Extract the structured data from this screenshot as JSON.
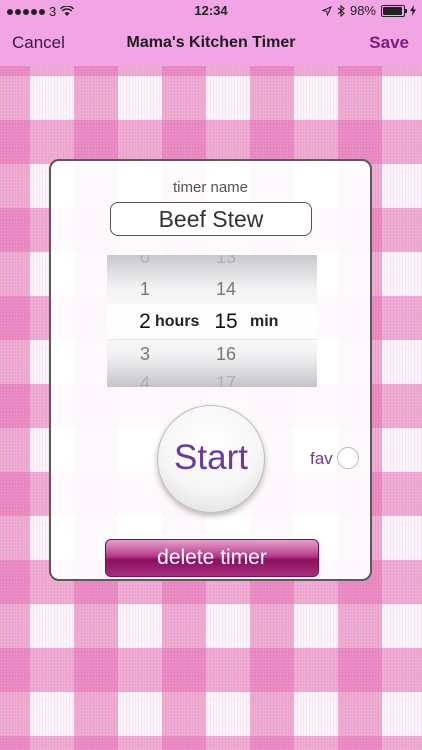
{
  "status_bar": {
    "carrier": "3",
    "time": "12:34",
    "battery": "98%"
  },
  "nav": {
    "cancel_label": "Cancel",
    "title": "Mama's Kitchen Timer",
    "save_label": "Save"
  },
  "form": {
    "timer_name_label": "timer name",
    "timer_name_value": "Beef Stew"
  },
  "picker": {
    "hours": [
      "0",
      "1",
      "2",
      "3",
      "4"
    ],
    "minutes": [
      "13",
      "14",
      "15",
      "16",
      "17"
    ],
    "selected_hours": "2",
    "selected_minutes": "15",
    "hours_unit": "hours",
    "minutes_unit": "min"
  },
  "actions": {
    "start_label": "Start",
    "fav_label": "fav",
    "delete_label": "delete timer"
  },
  "colors": {
    "nav_bar": "#f2a5e4",
    "accent_purple": "#6b3a9e",
    "delete_magenta": "#8c0f62"
  }
}
